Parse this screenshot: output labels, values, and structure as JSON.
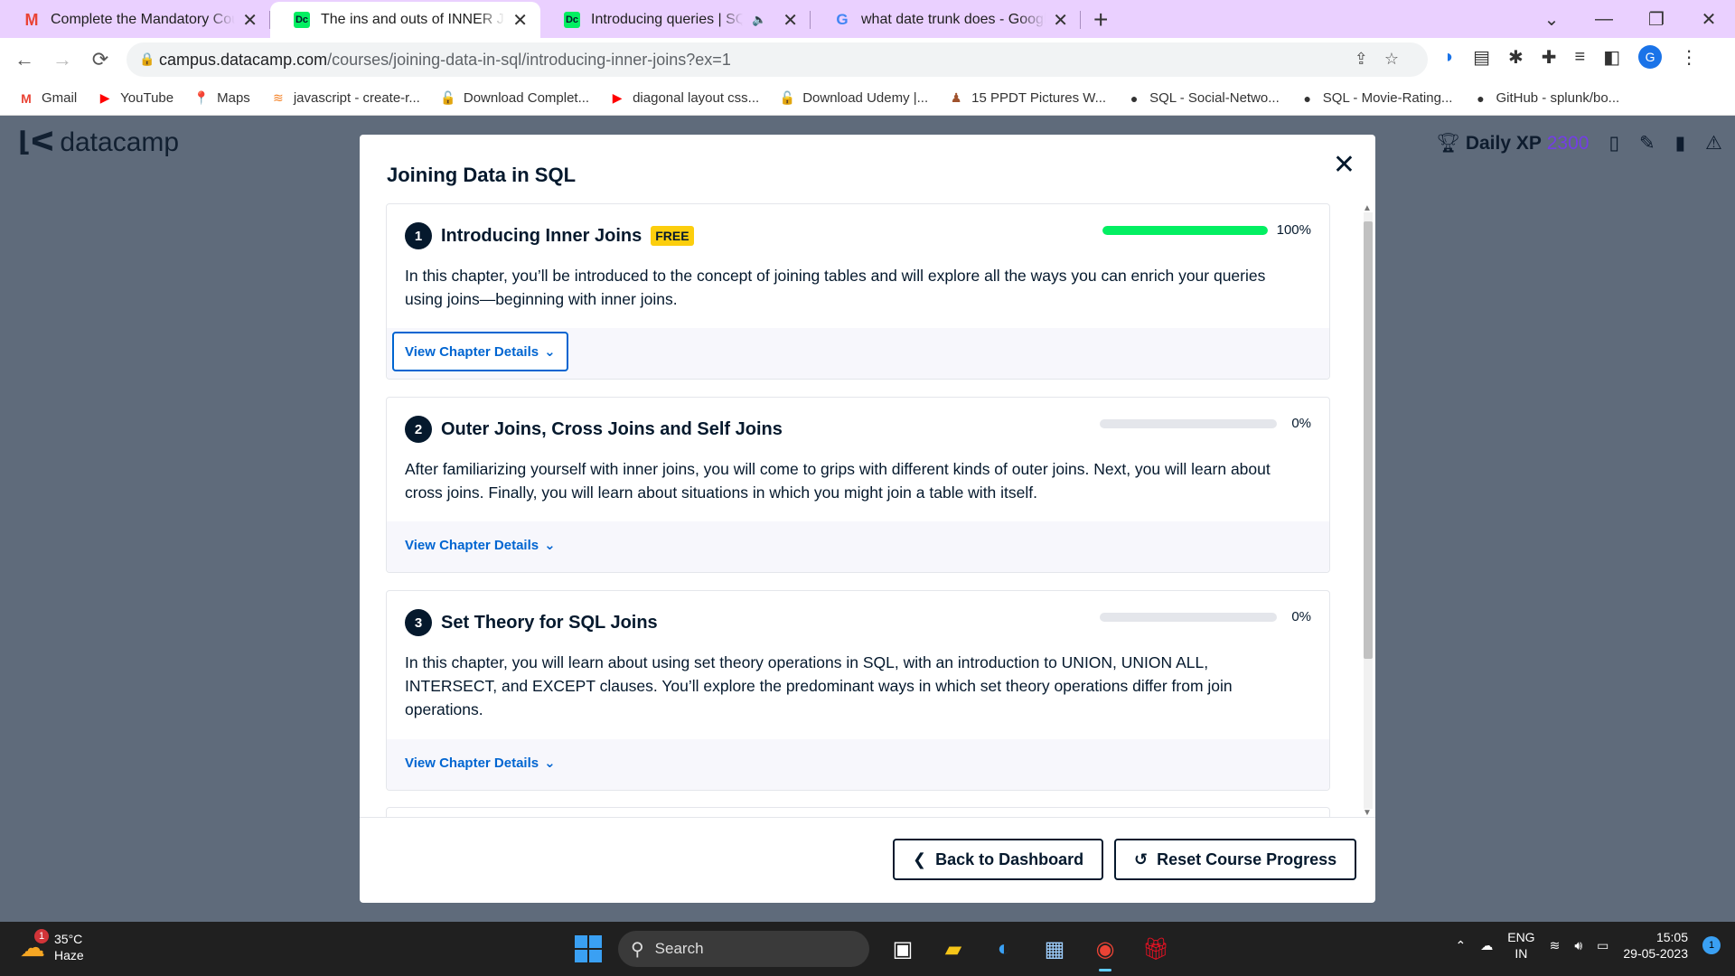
{
  "browser": {
    "tabs": [
      {
        "title": "Complete the Mandatory Course",
        "icon": "gmail-icon",
        "active": false
      },
      {
        "title": "The ins and outs of INNER JOIN |",
        "icon": "datacamp-icon",
        "active": true
      },
      {
        "title": "Introducing queries | SQL",
        "icon": "datacamp-icon",
        "active": false
      },
      {
        "title": "what date trunk does - Google S",
        "icon": "google-icon",
        "active": false
      }
    ],
    "url_host": "campus.datacamp.com",
    "url_path": "/courses/joining-data-in-sql/introducing-inner-joins?ex=1",
    "profile_initial": "G",
    "bookmarks": [
      {
        "label": "Gmail",
        "icon": "gmail-icon"
      },
      {
        "label": "YouTube",
        "icon": "youtube-icon"
      },
      {
        "label": "Maps",
        "icon": "maps-icon"
      },
      {
        "label": "javascript - create-r...",
        "icon": "stackoverflow-icon"
      },
      {
        "label": "Download Complet...",
        "icon": "lock-folder-icon"
      },
      {
        "label": "diagonal layout css...",
        "icon": "youtube-icon"
      },
      {
        "label": "Download Udemy |...",
        "icon": "lock-folder-icon"
      },
      {
        "label": "15 PPDT Pictures W...",
        "icon": "figure-icon"
      },
      {
        "label": "SQL - Social-Netwo...",
        "icon": "github-icon"
      },
      {
        "label": "SQL - Movie-Rating...",
        "icon": "github-icon"
      },
      {
        "label": "GitHub - splunk/bo...",
        "icon": "github-icon"
      }
    ]
  },
  "app": {
    "logo": "datacamp",
    "daily_xp_label": "Daily XP",
    "daily_xp_value": "2300"
  },
  "modal": {
    "title": "Joining Data in SQL",
    "chapters": [
      {
        "number": "1",
        "title": "Introducing Inner Joins",
        "badge": "FREE",
        "progress": 100,
        "progress_label": "100%",
        "description": "In this chapter, you’ll be introduced to the concept of joining tables and will explore all the ways you can enrich your queries using joins—beginning with inner joins.",
        "details_label": "View Chapter Details"
      },
      {
        "number": "2",
        "title": "Outer Joins, Cross Joins and Self Joins",
        "badge": "",
        "progress": 0,
        "progress_label": "0%",
        "description": "After familiarizing yourself with inner joins, you will come to grips with different kinds of outer joins. Next, you will learn about cross joins. Finally, you will learn about situations in which you might join a table with itself.",
        "details_label": "View Chapter Details"
      },
      {
        "number": "3",
        "title": "Set Theory for SQL Joins",
        "badge": "",
        "progress": 0,
        "progress_label": "0%",
        "description": "In this chapter, you will learn about using set theory operations in SQL, with an introduction to UNION, UNION ALL, INTERSECT, and EXCEPT clauses. You’ll explore the predominant ways in which set theory operations differ from join operations.",
        "details_label": "View Chapter Details"
      }
    ],
    "back_label": "Back to Dashboard",
    "reset_label": "Reset Course Progress"
  },
  "taskbar": {
    "temperature": "35°C",
    "weather": "Haze",
    "weather_badge": "1",
    "search_placeholder": "Search",
    "lang_line1": "ENG",
    "lang_line2": "IN",
    "time": "15:05",
    "date": "29-05-2023",
    "notification_count": "1"
  },
  "colors": {
    "brand_green": "#03ef62",
    "link_blue": "#0065d1",
    "badge_yellow": "#fcce0d",
    "navy": "#05192d",
    "xp_purple": "#7933ff"
  }
}
